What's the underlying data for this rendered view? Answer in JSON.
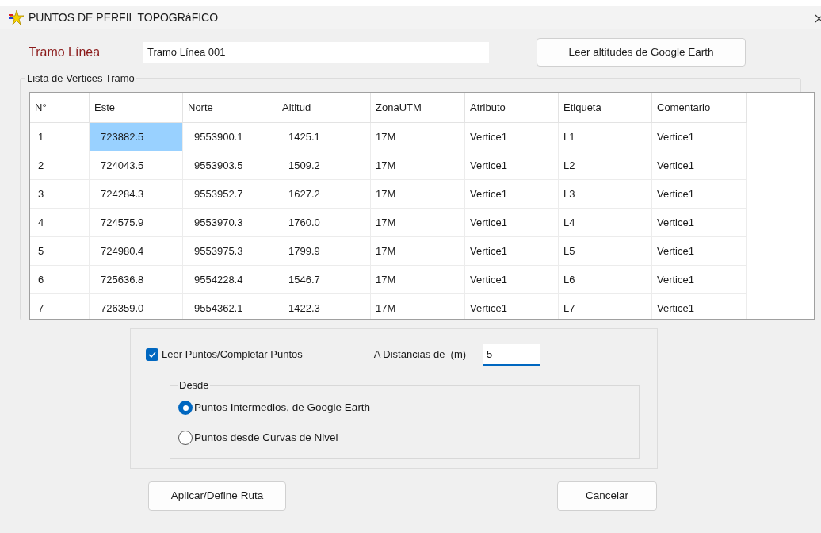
{
  "window": {
    "title": "PUNTOS DE PERFIL TOPOGRáFICO"
  },
  "tramo": {
    "label": "Tramo Línea",
    "value": "Tramo Línea 001"
  },
  "read_button": "Leer altitudes de Google Earth",
  "group_title": "Lista de Vertices Tramo",
  "table": {
    "columns": [
      {
        "label": "N°"
      },
      {
        "label": "Este"
      },
      {
        "label": "Norte"
      },
      {
        "label": "Altitud"
      },
      {
        "label": "ZonaUTM"
      },
      {
        "label": "Atributo"
      },
      {
        "label": "Etiqueta"
      },
      {
        "label": "Comentario"
      }
    ],
    "rows": [
      {
        "selected": true,
        "cells": [
          "1",
          "723882.5",
          "9553900.1",
          "1425.1",
          "17M",
          "Vertice1",
          "L1",
          "Vertice1"
        ]
      },
      {
        "selected": false,
        "cells": [
          "2",
          "724043.5",
          "9553903.5",
          "1509.2",
          "17M",
          "Vertice1",
          "L2",
          "Vertice1"
        ]
      },
      {
        "selected": false,
        "cells": [
          "3",
          "724284.3",
          "9553952.7",
          "1627.2",
          "17M",
          "Vertice1",
          "L3",
          "Vertice1"
        ]
      },
      {
        "selected": false,
        "cells": [
          "4",
          "724575.9",
          "9553970.3",
          "1760.0",
          "17M",
          "Vertice1",
          "L4",
          "Vertice1"
        ]
      },
      {
        "selected": false,
        "cells": [
          "5",
          "724980.4",
          "9553975.3",
          "1799.9",
          "17M",
          "Vertice1",
          "L5",
          "Vertice1"
        ]
      },
      {
        "selected": false,
        "cells": [
          "6",
          "725636.8",
          "9554228.4",
          "1546.7",
          "17M",
          "Vertice1",
          "L6",
          "Vertice1"
        ]
      },
      {
        "selected": false,
        "cells": [
          "7",
          "726359.0",
          "9554362.1",
          "1422.3",
          "17M",
          "Vertice1",
          "L7",
          "Vertice1"
        ]
      }
    ]
  },
  "options": {
    "checkbox": {
      "label": "Leer Puntos/Completar Puntos",
      "checked": true
    },
    "distance": {
      "label": "A Distancias de  (m)",
      "value": "5"
    },
    "desde": {
      "title": "Desde",
      "radios": [
        {
          "label": "Puntos Intermedios, de Google Earth",
          "selected": true
        },
        {
          "label": "Puntos desde Curvas de Nivel",
          "selected": false
        }
      ]
    }
  },
  "buttons": [
    "Aplicar/Define Ruta",
    "Cancelar"
  ]
}
